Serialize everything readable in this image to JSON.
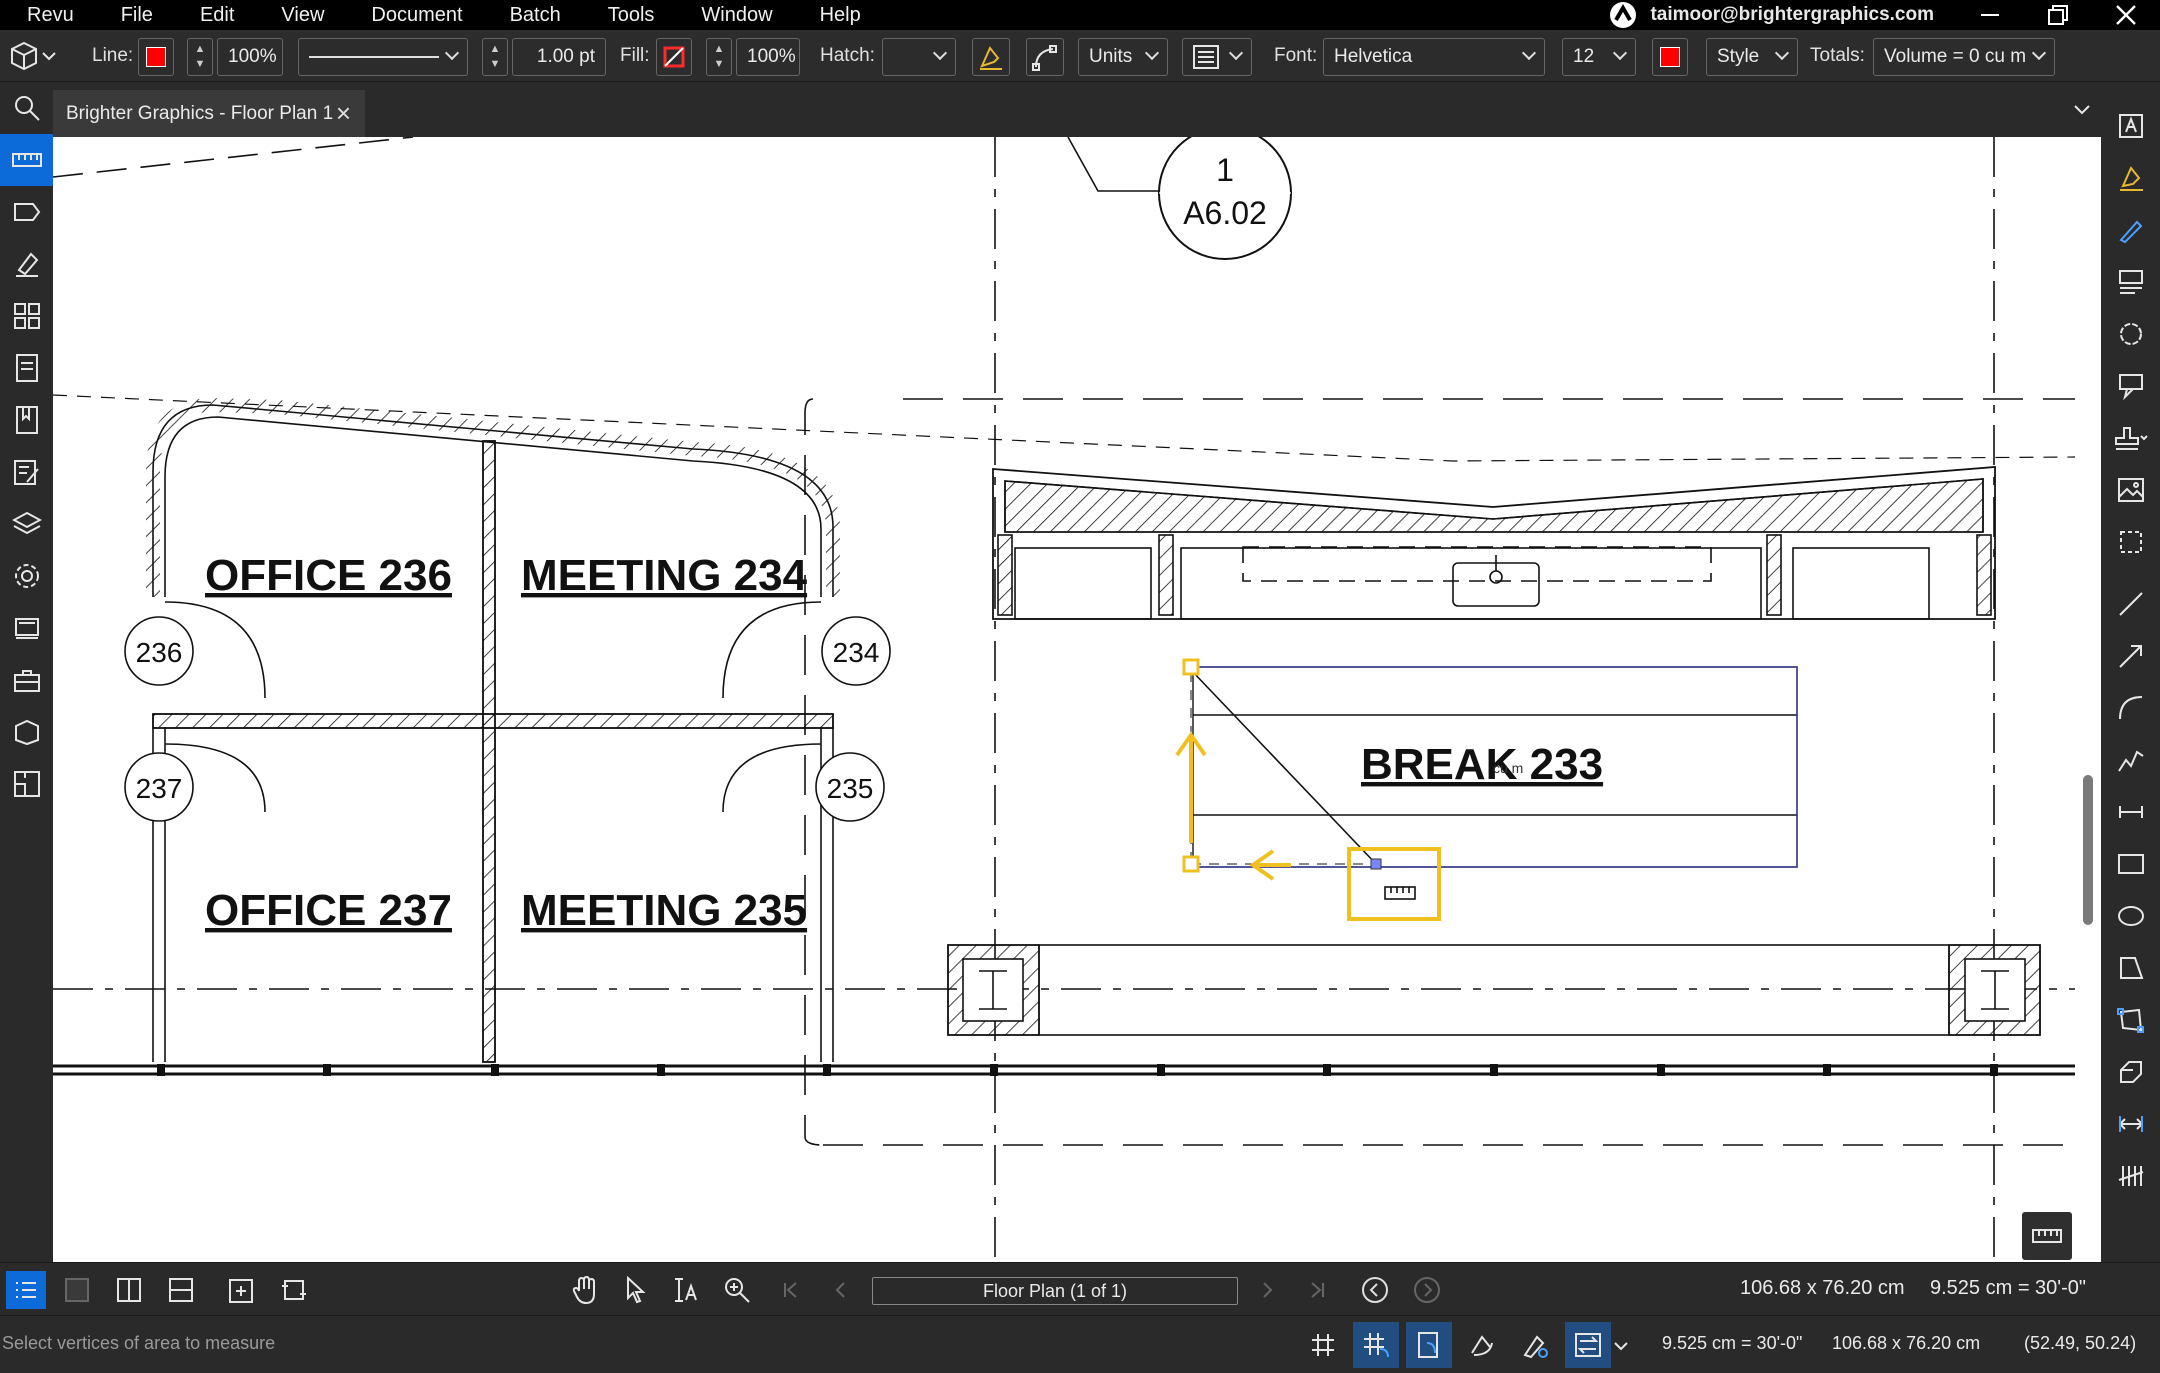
{
  "menu": {
    "items": [
      "Revu",
      "File",
      "Edit",
      "View",
      "Document",
      "Batch",
      "Tools",
      "Window",
      "Help"
    ],
    "user": "taimoor@brightergraphics.com"
  },
  "toolbar": {
    "line_label": "Line:",
    "line_opacity": "100%",
    "line_width": "1.00 pt",
    "fill_label": "Fill:",
    "fill_opacity": "100%",
    "hatch_label": "Hatch:",
    "units": "Units",
    "font_label": "Font:",
    "font_name": "Helvetica",
    "font_size": "12",
    "style": "Style",
    "totals_label": "Totals:",
    "totals_value": "Volume = 0 cu m",
    "color": "#ff0000"
  },
  "tab": {
    "title": "Brighter Graphics - Floor Plan 1"
  },
  "drawing": {
    "rooms": [
      {
        "label": "OFFICE   236"
      },
      {
        "label": "MEETING   234"
      },
      {
        "label": "OFFICE   237"
      },
      {
        "label": "MEETING   235"
      },
      {
        "label": "BREAK   233"
      }
    ],
    "door_tags": [
      "236",
      "234",
      "237",
      "235"
    ],
    "section_tag": {
      "number": "1",
      "sheet": "A6.02"
    },
    "measure_hint": "cu m"
  },
  "nav": {
    "page": "Floor Plan (1 of 1)",
    "page_size": "106.68 x 76.20 cm",
    "scale": "9.525 cm = 30'-0\""
  },
  "status": {
    "hint": "Select vertices of area to measure",
    "scale": "9.525 cm = 30'-0\"",
    "size": "106.68 x 76.20 cm",
    "coords": "(52.49, 50.24)"
  }
}
